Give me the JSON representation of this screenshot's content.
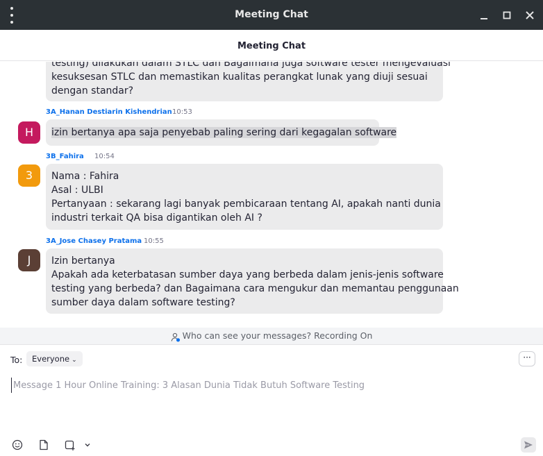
{
  "window": {
    "title": "Meeting Chat"
  },
  "header": {
    "title": "Meeting Chat"
  },
  "messages": [
    {
      "lines": [
        "testing) dilakukan dalam STLC dan Bagaimana juga software tester mengevaluasi",
        "kesuksesan STLC dan memastikan kualitas perangkat lunak yang diuji sesuai",
        "dengan standar?"
      ]
    },
    {
      "sender": "3A_Hanan Destiarin Kishendrian",
      "time": "10:53",
      "avatar_letter": "H",
      "avatar_color": "#c41a5e",
      "lines": [
        "izin bertanya apa saja penyebab paling sering dari kegagalan software"
      ]
    },
    {
      "sender": "3B_Fahira",
      "time": "10:54",
      "avatar_letter": "3",
      "avatar_color": "#f29a0d",
      "lines": [
        "Nama : Fahira",
        "Asal : ULBI",
        "Pertanyaan : sekarang lagi banyak pembicaraan tentang AI, apakah nanti dunia",
        "industri terkait QA bisa digantikan oleh AI ?"
      ]
    },
    {
      "sender": "3A_Jose Chasey Pratama",
      "time": "10:55",
      "avatar_letter": "J",
      "avatar_color": "#5b3f35",
      "lines": [
        "Izin bertanya",
        "Apakah ada keterbatasan sumber daya yang berbeda dalam jenis-jenis software",
        "testing yang berbeda? dan Bagaimana cara mengukur dan memantau penggunaan",
        "sumber daya dalam software testing?"
      ]
    }
  ],
  "recording": {
    "text": "Who can see your messages? Recording On"
  },
  "compose": {
    "to_label": "To:",
    "recipient": "Everyone",
    "placeholder": "Message 1 Hour Online Training: 3 Alasan Dunia Tidak Butuh Software Testing",
    "more_label": "···"
  },
  "toolbar": {
    "icons": [
      "emoji-icon",
      "file-icon",
      "screenshot-icon",
      "chevron-down-icon",
      "send-icon"
    ]
  }
}
